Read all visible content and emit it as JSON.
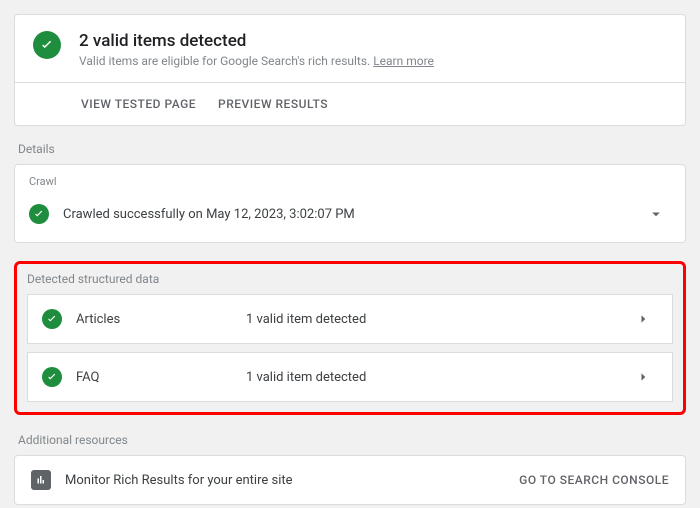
{
  "summary": {
    "title": "2 valid items detected",
    "subtitle_prefix": "Valid items are eligible for Google Search's rich results. ",
    "learn_more": "Learn more",
    "view_tested": "VIEW TESTED PAGE",
    "preview_results": "PREVIEW RESULTS"
  },
  "details": {
    "label": "Details",
    "crawl_label": "Crawl",
    "crawl_text": "Crawled successfully on May 12, 2023, 3:02:07 PM"
  },
  "structured": {
    "label": "Detected structured data",
    "items": [
      {
        "type": "Articles",
        "status": "1 valid item detected"
      },
      {
        "type": "FAQ",
        "status": "1 valid item detected"
      }
    ]
  },
  "resources": {
    "label": "Additional resources",
    "text": "Monitor Rich Results for your entire site",
    "cta": "GO TO SEARCH CONSOLE"
  }
}
